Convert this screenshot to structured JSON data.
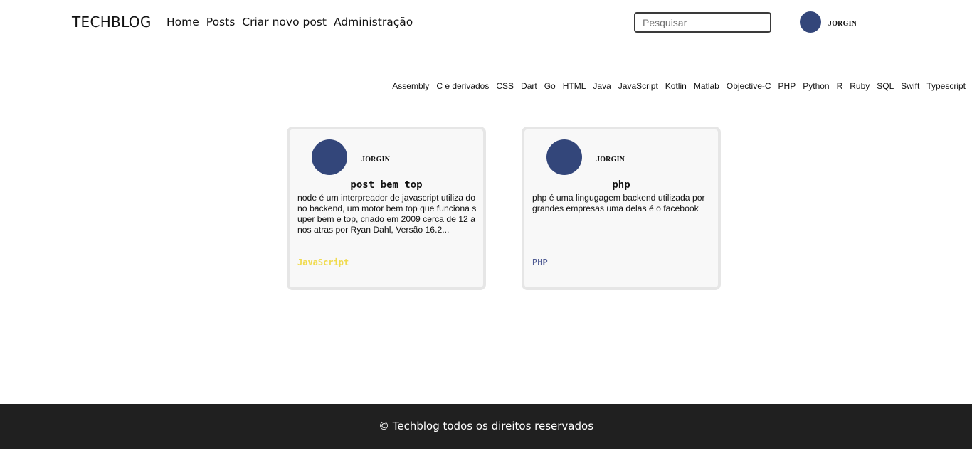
{
  "header": {
    "brand": "TECHBLOG",
    "nav": [
      "Home",
      "Posts",
      "Criar novo post",
      "Administração"
    ],
    "search_placeholder": "Pesquisar",
    "username": "JORGIN"
  },
  "categories": [
    "Assembly",
    "C e derivados",
    "CSS",
    "Dart",
    "Go",
    "HTML",
    "Java",
    "JavaScript",
    "Kotlin",
    "Matlab",
    "Objective-C",
    "PHP",
    "Python",
    "R",
    "Ruby",
    "SQL",
    "Swift",
    "Typescript"
  ],
  "posts": [
    {
      "author": "JORGIN",
      "title": "post bem top",
      "excerpt": "node é um interpreador de javascript utiliza do no backend, um motor bem top que funciona super bem e top, criado em 2009 cerca de 12 anos atras por Ryan Dahl, Versão 16.2...",
      "tag": "JavaScript",
      "tag_color": "#f0db4f"
    },
    {
      "author": "JORGIN",
      "title": "php",
      "excerpt": "php é uma lingugagem backend utilizada por grandes empresas uma delas é o facebook",
      "tag": "PHP",
      "tag_color": "#4f5b93"
    }
  ],
  "footer": {
    "text": "© Techblog todos os direitos reservados"
  },
  "colors": {
    "avatar": "#33467a",
    "footer_bg": "#202020"
  }
}
